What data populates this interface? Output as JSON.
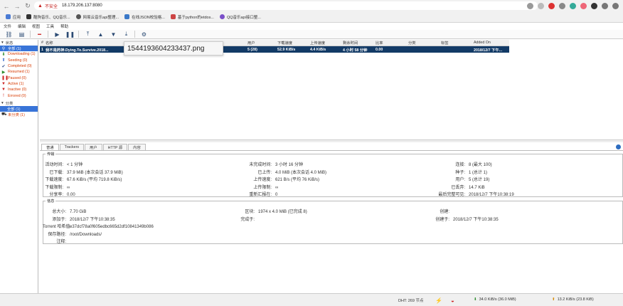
{
  "browser": {
    "insecure_label": "不安全",
    "url": "18.179.206.137:8080",
    "bookmarks": [
      "应用",
      "酷狗音乐、QQ音乐...",
      "网易云音乐api整理...",
      "在线JSON校验格...",
      "基于python的etdos...",
      "QQ音乐api接口整..."
    ]
  },
  "menu": [
    "文件",
    "编辑",
    "视图",
    "工具",
    "帮助"
  ],
  "sidebar": {
    "status_header": "状态",
    "status_items": [
      {
        "label": "全部 (1)",
        "icon": "all-icon",
        "color": "#222"
      },
      {
        "label": "Downloading (1)",
        "icon": "download-arrow-icon",
        "color": "#d73a00"
      },
      {
        "label": "Seeding (0)",
        "icon": "seed-arrow-icon",
        "color": "#d73a00"
      },
      {
        "label": "Completed (0)",
        "icon": "check-icon",
        "color": "#d73a00"
      },
      {
        "label": "Resumed (1)",
        "icon": "resume-icon",
        "color": "#d73a00"
      },
      {
        "label": "Paused (0)",
        "icon": "pause-icon",
        "color": "#d73a00"
      },
      {
        "label": "Active (1)",
        "icon": "filter-icon",
        "color": "#d73a00"
      },
      {
        "label": "Inactive (0)",
        "icon": "filter-icon",
        "color": "#d73a00"
      },
      {
        "label": "Errored (0)",
        "icon": "error-icon",
        "color": "#d73a00"
      }
    ],
    "category_header": "分类",
    "category_items": [
      {
        "label": "全部 (1)",
        "selected": true
      },
      {
        "label": "未分类 (1)",
        "selected": false
      }
    ]
  },
  "table": {
    "headers": [
      "#",
      "名称",
      "",
      "用户",
      "下载速度",
      "上传速度",
      "剩余时间",
      "比率",
      "分类",
      "标签",
      "Added On"
    ],
    "rows": [
      [
        "1",
        "我不是药神.Dying.To.Survive.2018...",
        "",
        "5 (28)",
        "52.9 KiB/s",
        "4.4 KiB/s",
        "4 小时 58 分钟",
        "0.00",
        "",
        "",
        "2018/12/7 下午..."
      ]
    ]
  },
  "tooltip": "1544193604233437.png",
  "tabs": [
    "普通",
    "Trackers",
    "用户",
    "HTTP 源",
    "内容"
  ],
  "transfer": {
    "legend": "传输",
    "col1": [
      {
        "k": "活动时间:",
        "v": "< 1 分钟"
      },
      {
        "k": "已下载:",
        "v": "37.9 MiB (本次会话 37.9 MiB)"
      },
      {
        "k": "下载速度:",
        "v": "67.6 KiB/s (平均 719.8 KiB/s)"
      },
      {
        "k": "下载限制:",
        "v": "∞"
      },
      {
        "k": "分享率:",
        "v": "0.00"
      }
    ],
    "col2": [
      {
        "k": "未完成时间:",
        "v": "3 小时 16 分钟"
      },
      {
        "k": "已上传:",
        "v": "4.0 MiB (本次会话 4.0 MiB)"
      },
      {
        "k": "上传速度:",
        "v": "621 B/s (平均 76 KiB/s)"
      },
      {
        "k": "上传限制:",
        "v": "∞"
      },
      {
        "k": "重新汇报在:",
        "v": "0"
      }
    ],
    "col3": [
      {
        "k": "连接:",
        "v": "8 (最大 100)"
      },
      {
        "k": "种子:",
        "v": "1 (总计 1)"
      },
      {
        "k": "用户:",
        "v": "5 (总计 19)"
      },
      {
        "k": "已丢弃:",
        "v": "14.7 KiB"
      },
      {
        "k": "最后完整可见:",
        "v": "2018/12/7 下午10:38:19"
      }
    ]
  },
  "info": {
    "legend": "信息",
    "col1": [
      {
        "k": "总大小:",
        "v": "7.70 GiB"
      },
      {
        "k": "添加于:",
        "v": "2018/12/7 下午10:38:35"
      },
      {
        "k": "Torrent 哈希值:",
        "v": "e37dcf78a0f605edbc665d2df10841349b086"
      },
      {
        "k": "保存路径:",
        "v": "/root/Downloads/"
      },
      {
        "k": "注释:",
        "v": ""
      }
    ],
    "col2": [
      {
        "k": "区块:",
        "v": "1974 x 4.0 MiB (已完成 8)"
      },
      {
        "k": "完成于:",
        "v": ""
      }
    ],
    "col3": [
      {
        "k": "创建:",
        "v": ""
      },
      {
        "k": "创建于:",
        "v": "2018/12/7 下午10:38:35"
      }
    ]
  },
  "status": {
    "dht": "DHT: 269 节点",
    "down": "34.0 KiB/s (36.0 MiB)",
    "up": "13.2 KiB/s (23.8 KiB)"
  }
}
